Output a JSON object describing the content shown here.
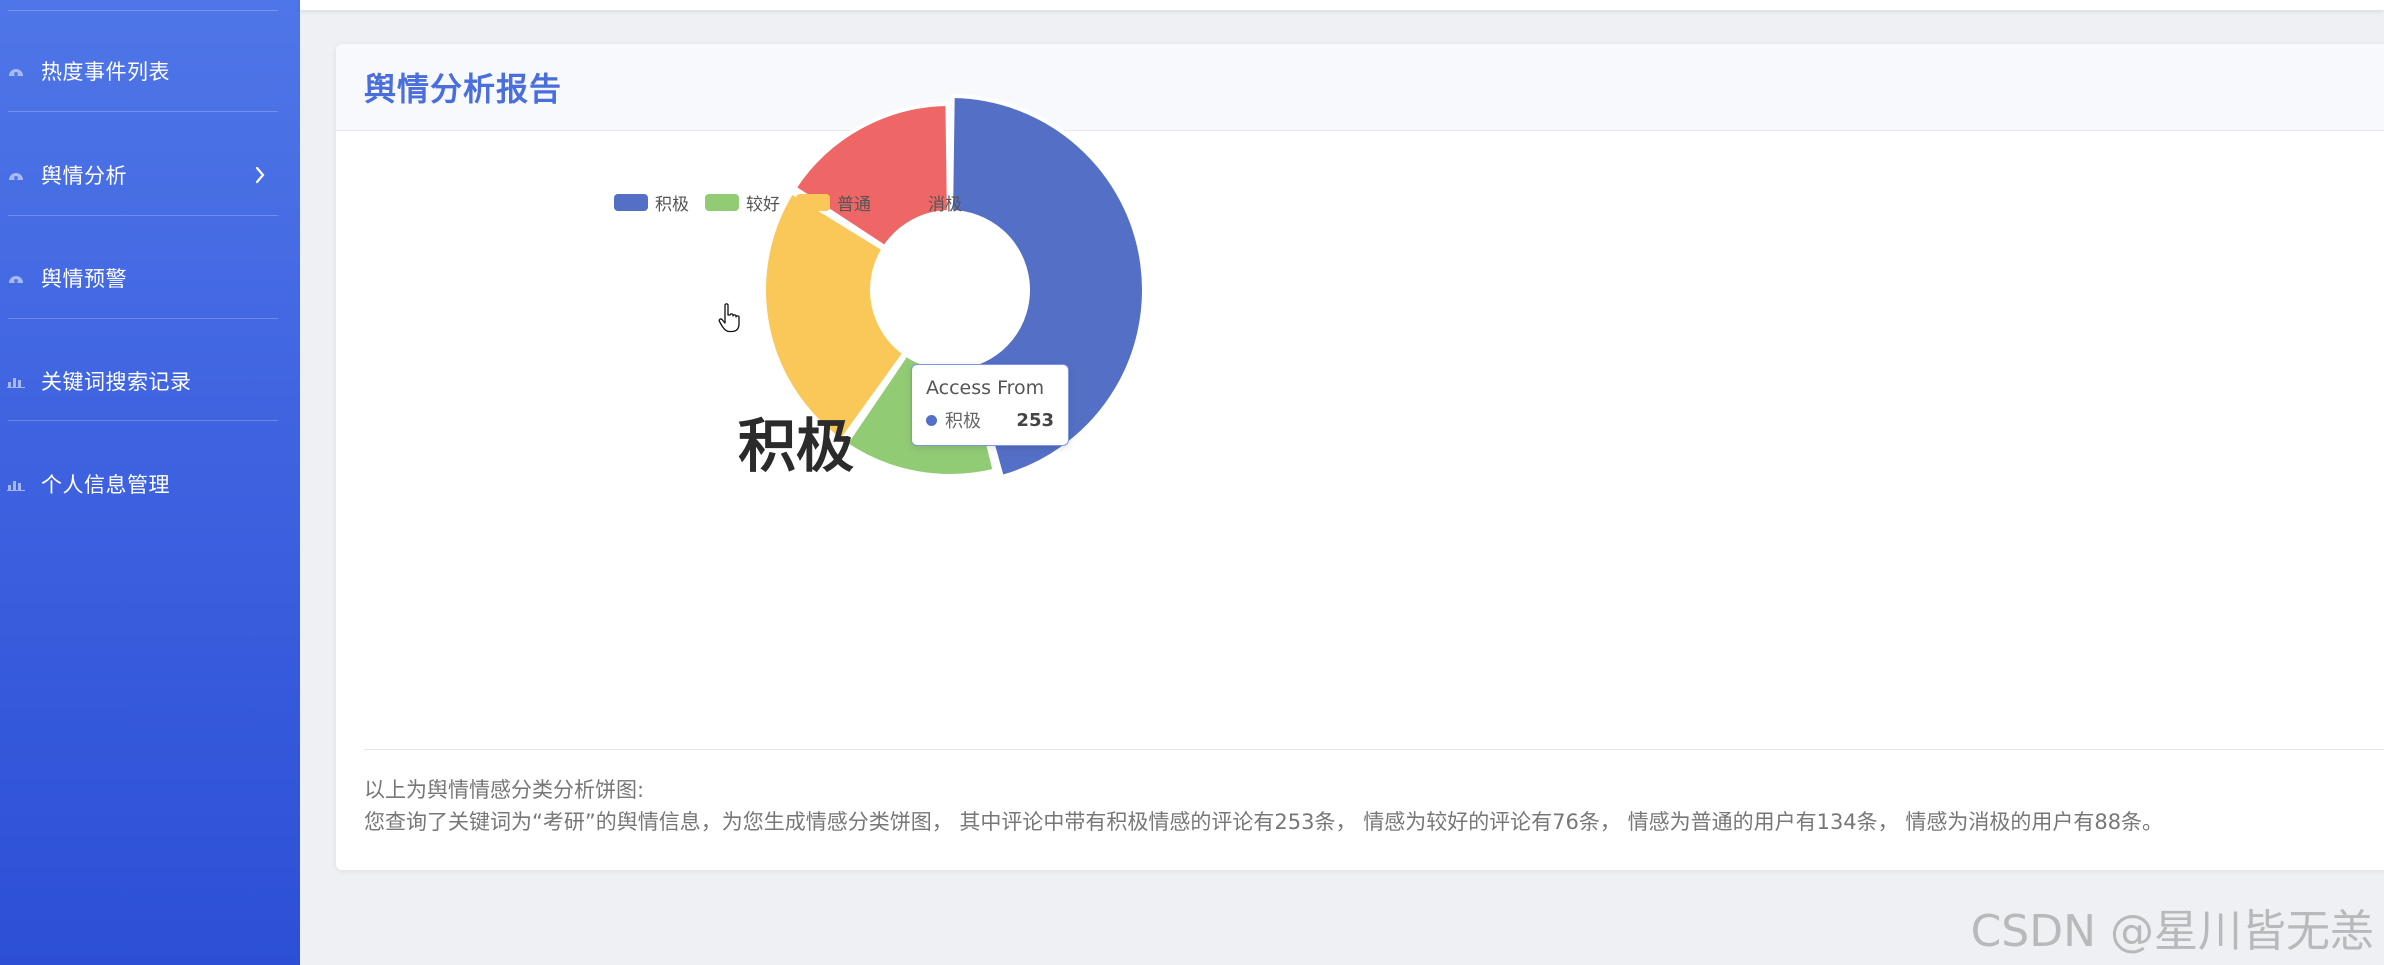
{
  "sidebar": {
    "items": [
      {
        "label": "热度事件列表",
        "icon": "gauge-icon",
        "has_chevron": false
      },
      {
        "label": "舆情分析",
        "icon": "gauge-icon",
        "has_chevron": true
      },
      {
        "label": "舆情预警",
        "icon": "gauge-icon",
        "has_chevron": false
      },
      {
        "label": "关键词搜索记录",
        "icon": "bar-chart-icon",
        "has_chevron": false
      },
      {
        "label": "个人信息管理",
        "icon": "bar-chart-icon",
        "has_chevron": false
      }
    ]
  },
  "card": {
    "title": "舆情分析报告",
    "description_heading": "以上为舆情情感分类分析饼图:",
    "description_body": "您查询了关键词为“考研”的舆情信息，为您生成情感分类饼图， 其中评论中带有积极情感的评论有253条， 情感为较好的评论有76条， 情感为普通的用户有134条， 情感为消极的用户有88条。"
  },
  "chart_data": {
    "type": "pie",
    "variant": "donut",
    "categories": [
      "积极",
      "较好",
      "普通",
      "消极"
    ],
    "values": [
      253,
      76,
      134,
      88
    ],
    "colors": [
      "#5470c6",
      "#91cc75",
      "#fac858",
      "#ee6666"
    ],
    "legend_position": "top",
    "center_label": "积极",
    "tooltip": {
      "title": "Access From",
      "name": "积极",
      "value": "253"
    }
  },
  "watermark": "CSDN @星川皆无恙"
}
